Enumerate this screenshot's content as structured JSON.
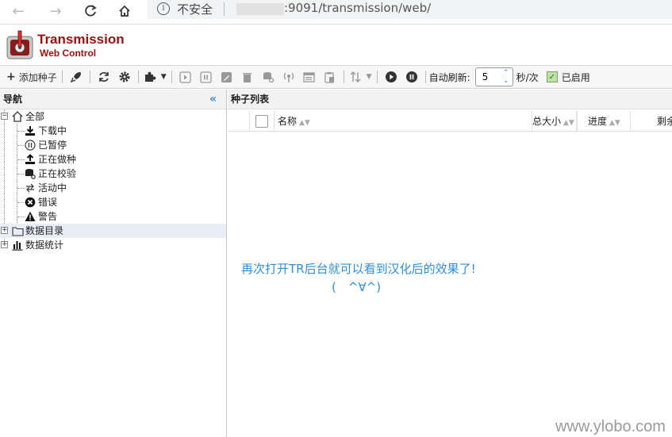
{
  "browser": {
    "security_label": "不安全",
    "url": ":9091/transmission/web/"
  },
  "app": {
    "title": "Transmission",
    "subtitle": "Web Control"
  },
  "toolbar": {
    "add_torrent": "添加种子",
    "auto_refresh_label": "自动刷新:",
    "auto_refresh_value": "5",
    "refresh_unit": "秒/次",
    "enabled_label": "已启用"
  },
  "nav": {
    "header": "导航",
    "items": [
      {
        "label": "全部"
      },
      {
        "label": "下载中"
      },
      {
        "label": "已暂停"
      },
      {
        "label": "正在做种"
      },
      {
        "label": "正在校验"
      },
      {
        "label": "活动中"
      },
      {
        "label": "错误"
      },
      {
        "label": "警告"
      },
      {
        "label": "数据目录"
      },
      {
        "label": "数据统计"
      }
    ]
  },
  "main": {
    "header": "种子列表",
    "columns": [
      "名称",
      "总大小",
      "进度",
      "剩余"
    ],
    "message_line1": "再次打开TR后台就可以看到汉化后的效果了!",
    "message_line2": "(　^∀^)"
  },
  "watermark": "www.ylobo.com",
  "colors": {
    "brand": "#9b0f0f",
    "message": "#2f8fd8",
    "accent": "#3b8ad8"
  }
}
